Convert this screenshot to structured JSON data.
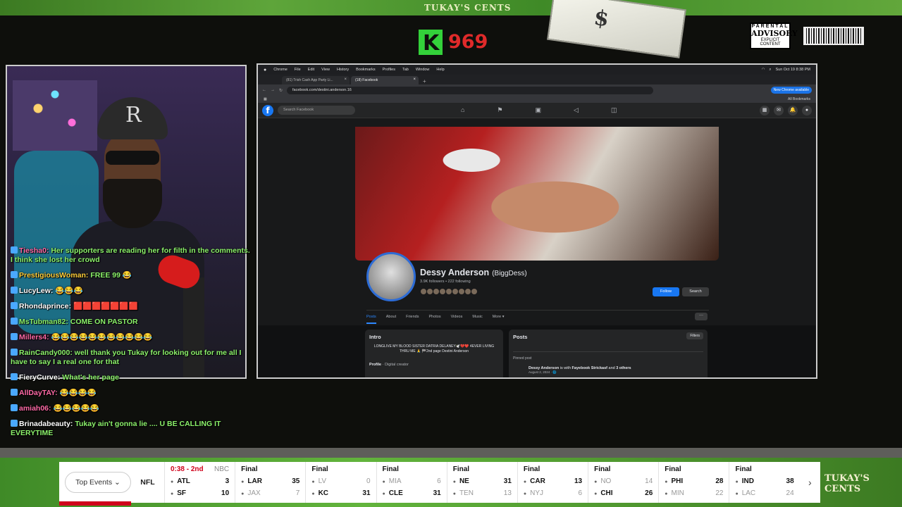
{
  "overlay": {
    "brand_top": "TUKAY'S CENTS",
    "kick_count": "969",
    "kick_logo": "K",
    "money_label": "$",
    "advisory_l1": "PARENTAL",
    "advisory_l2": "ADVISORY",
    "advisory_l3": "EXPLICIT CONTENT",
    "brand_bottom": "TUKAY'S CENTS",
    "webcam_hat_letter": "R"
  },
  "chat": [
    {
      "user": "Tiesha0:",
      "text": "Her supporters are reading her for filth in the comments. I think she lost her crowd",
      "color": "pink"
    },
    {
      "user": "PrestigiousWoman:",
      "text": "FREE 99 😂",
      "color": "gold"
    },
    {
      "user": "LucyLew:",
      "text": "😂😂😂",
      "color": "white"
    },
    {
      "user": "Rhondaprince:",
      "text": "🟥🟥🟥🟥🟥🟥🟥",
      "color": "white"
    },
    {
      "user": "MsTubman82:",
      "text": "COME ON PASTOR",
      "color": "green"
    },
    {
      "user": "Millers4:",
      "text": "😂😂😂😂😂😂😂😂😂😂😂",
      "color": "pink"
    },
    {
      "user": "RainCandy000:",
      "text": "well thank you Tukay for looking out for me all I have to say I a real one for that",
      "color": "green"
    },
    {
      "user": "FieryCurve:",
      "text": "What's her page",
      "color": "white"
    },
    {
      "user": "AllDayTAY:",
      "text": "😂😂😂😂",
      "color": "pink"
    },
    {
      "user": "amiah06:",
      "text": "😂😂😂😂😂",
      "color": "pink"
    },
    {
      "user": "Brinadabeauty:",
      "text": "Tukay ain't gonna lie .... U BE CALLING IT EVERYTIME",
      "color": "white"
    }
  ],
  "browser": {
    "menu": [
      "Chrome",
      "File",
      "Edit",
      "View",
      "History",
      "Bookmarks",
      "Profiles",
      "Tab",
      "Window",
      "Help"
    ],
    "clock": "Sun Oct 19  8:38 PM",
    "tabs": [
      {
        "label": "(81) Trish Cash App Party Li..."
      },
      {
        "label": "(18) Facebook"
      }
    ],
    "url": "facebook.com/destini.anderson.16",
    "update_label": "New Chrome available",
    "all_bookmarks": "All Bookmarks"
  },
  "facebook": {
    "search_placeholder": "Search Facebook",
    "name": "Dessy Anderson",
    "alt_name": "(BiggDess)",
    "stats": "3.9K followers • 222 following",
    "follow_label": "Follow",
    "search_label": "Search",
    "tabs": [
      "Posts",
      "About",
      "Friends",
      "Photos",
      "Videos",
      "Music",
      "More ▾"
    ],
    "intro_title": "Intro",
    "intro_bio": "LONGLIVE MY BLOOD SISTER DATRIA DELANEY🕊️💔❤️ 4EVER LIVING THRU ME 🙏 🏁2nd page Destini Anderson",
    "profile_label": "Profile",
    "profile_detail": " · Digital creator",
    "posts_title": "Posts",
    "filters_label": "Filters",
    "pinned_label": "Pinned post",
    "post_author": "Dessy Anderson",
    "post_text": " is with ",
    "post_with": "Fayebook Strickasf",
    "post_and": " and ",
    "post_others": "3 others",
    "post_date": "August 2, 2024 · 🌐"
  },
  "scoreboard": {
    "top_events_label": "Top Events ⌄",
    "league": "NFL",
    "games": [
      {
        "status": "0:38 - 2nd",
        "network": "NBC",
        "live": true,
        "t1": "ATL",
        "s1": "3",
        "t2": "SF",
        "s2": "10",
        "w1": true,
        "w2": true
      },
      {
        "status": "Final",
        "network": "",
        "live": false,
        "t1": "LAR",
        "s1": "35",
        "t2": "JAX",
        "s2": "7",
        "w1": true,
        "w2": false
      },
      {
        "status": "Final",
        "network": "",
        "live": false,
        "t1": "LV",
        "s1": "0",
        "t2": "KC",
        "s2": "31",
        "w1": false,
        "w2": true
      },
      {
        "status": "Final",
        "network": "",
        "live": false,
        "t1": "MIA",
        "s1": "6",
        "t2": "CLE",
        "s2": "31",
        "w1": false,
        "w2": true
      },
      {
        "status": "Final",
        "network": "",
        "live": false,
        "t1": "NE",
        "s1": "31",
        "t2": "TEN",
        "s2": "13",
        "w1": true,
        "w2": false
      },
      {
        "status": "Final",
        "network": "",
        "live": false,
        "t1": "CAR",
        "s1": "13",
        "t2": "NYJ",
        "s2": "6",
        "w1": true,
        "w2": false
      },
      {
        "status": "Final",
        "network": "",
        "live": false,
        "t1": "NO",
        "s1": "14",
        "t2": "CHI",
        "s2": "26",
        "w1": false,
        "w2": true
      },
      {
        "status": "Final",
        "network": "",
        "live": false,
        "t1": "PHI",
        "s1": "28",
        "t2": "MIN",
        "s2": "22",
        "w1": true,
        "w2": false
      },
      {
        "status": "Final",
        "network": "",
        "live": false,
        "t1": "IND",
        "s1": "38",
        "t2": "LAC",
        "s2": "24",
        "w1": true,
        "w2": false
      }
    ],
    "next_arrow": "›"
  }
}
